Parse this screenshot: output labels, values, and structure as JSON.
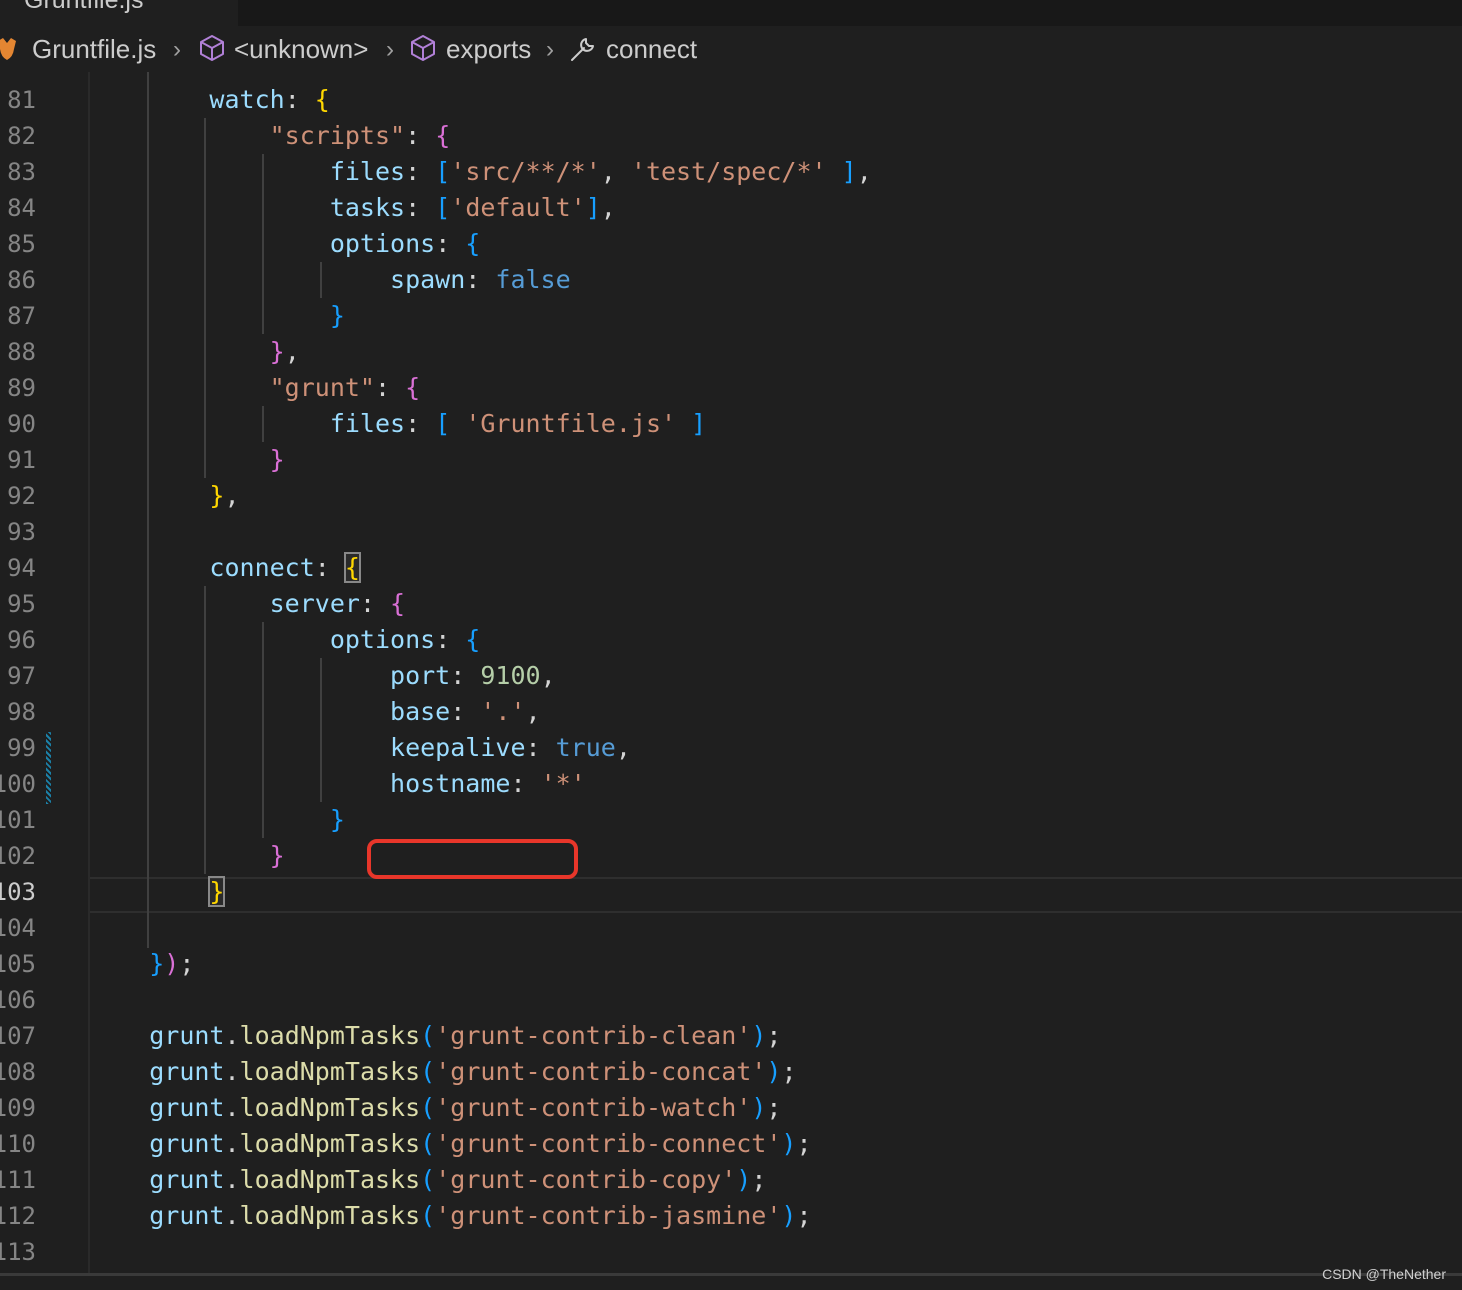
{
  "tab": {
    "label": "Gruntfile.js"
  },
  "breadcrumb": {
    "file": "Gruntfile.js",
    "items": [
      "<unknown>",
      "exports",
      "connect"
    ]
  },
  "editor": {
    "active_line": "103",
    "lines": [
      {
        "num": "81",
        "tokens": [
          {
            "t": "        ",
            "c": "p"
          },
          {
            "t": "watch",
            "c": "prop"
          },
          {
            "t": ": ",
            "c": "p"
          },
          {
            "t": "{",
            "c": "b1"
          }
        ]
      },
      {
        "num": "82",
        "tokens": [
          {
            "t": "            ",
            "c": "p"
          },
          {
            "t": "\"scripts\"",
            "c": "str"
          },
          {
            "t": ": ",
            "c": "p"
          },
          {
            "t": "{",
            "c": "b2"
          }
        ]
      },
      {
        "num": "83",
        "tokens": [
          {
            "t": "                ",
            "c": "p"
          },
          {
            "t": "files",
            "c": "prop"
          },
          {
            "t": ": ",
            "c": "p"
          },
          {
            "t": "[",
            "c": "b3"
          },
          {
            "t": "'src/**/*'",
            "c": "str"
          },
          {
            "t": ", ",
            "c": "p"
          },
          {
            "t": "'test/spec/*'",
            "c": "str"
          },
          {
            "t": " ",
            "c": "p"
          },
          {
            "t": "]",
            "c": "b3"
          },
          {
            "t": ",",
            "c": "p"
          }
        ]
      },
      {
        "num": "84",
        "tokens": [
          {
            "t": "                ",
            "c": "p"
          },
          {
            "t": "tasks",
            "c": "prop"
          },
          {
            "t": ": ",
            "c": "p"
          },
          {
            "t": "[",
            "c": "b3"
          },
          {
            "t": "'default'",
            "c": "str"
          },
          {
            "t": "]",
            "c": "b3"
          },
          {
            "t": ",",
            "c": "p"
          }
        ]
      },
      {
        "num": "85",
        "tokens": [
          {
            "t": "                ",
            "c": "p"
          },
          {
            "t": "options",
            "c": "prop"
          },
          {
            "t": ": ",
            "c": "p"
          },
          {
            "t": "{",
            "c": "b3"
          }
        ]
      },
      {
        "num": "86",
        "tokens": [
          {
            "t": "                    ",
            "c": "p"
          },
          {
            "t": "spawn",
            "c": "prop"
          },
          {
            "t": ": ",
            "c": "p"
          },
          {
            "t": "false",
            "c": "bool"
          }
        ]
      },
      {
        "num": "87",
        "tokens": [
          {
            "t": "                ",
            "c": "p"
          },
          {
            "t": "}",
            "c": "b3"
          }
        ]
      },
      {
        "num": "88",
        "tokens": [
          {
            "t": "            ",
            "c": "p"
          },
          {
            "t": "}",
            "c": "b2"
          },
          {
            "t": ",",
            "c": "p"
          }
        ]
      },
      {
        "num": "89",
        "tokens": [
          {
            "t": "            ",
            "c": "p"
          },
          {
            "t": "\"grunt\"",
            "c": "str"
          },
          {
            "t": ": ",
            "c": "p"
          },
          {
            "t": "{",
            "c": "b2"
          }
        ]
      },
      {
        "num": "90",
        "tokens": [
          {
            "t": "                ",
            "c": "p"
          },
          {
            "t": "files",
            "c": "prop"
          },
          {
            "t": ": ",
            "c": "p"
          },
          {
            "t": "[",
            "c": "b3"
          },
          {
            "t": " ",
            "c": "p"
          },
          {
            "t": "'Gruntfile.js'",
            "c": "str"
          },
          {
            "t": " ",
            "c": "p"
          },
          {
            "t": "]",
            "c": "b3"
          }
        ]
      },
      {
        "num": "91",
        "tokens": [
          {
            "t": "            ",
            "c": "p"
          },
          {
            "t": "}",
            "c": "b2"
          }
        ]
      },
      {
        "num": "92",
        "tokens": [
          {
            "t": "        ",
            "c": "p"
          },
          {
            "t": "}",
            "c": "b1"
          },
          {
            "t": ",",
            "c": "p"
          }
        ]
      },
      {
        "num": "93",
        "tokens": []
      },
      {
        "num": "94",
        "tokens": [
          {
            "t": "        ",
            "c": "p"
          },
          {
            "t": "connect",
            "c": "prop"
          },
          {
            "t": ": ",
            "c": "p"
          },
          {
            "t": "{",
            "c": "b1",
            "m": true
          }
        ]
      },
      {
        "num": "95",
        "tokens": [
          {
            "t": "            ",
            "c": "p"
          },
          {
            "t": "server",
            "c": "prop"
          },
          {
            "t": ": ",
            "c": "p"
          },
          {
            "t": "{",
            "c": "b2"
          }
        ]
      },
      {
        "num": "96",
        "tokens": [
          {
            "t": "                ",
            "c": "p"
          },
          {
            "t": "options",
            "c": "prop"
          },
          {
            "t": ": ",
            "c": "p"
          },
          {
            "t": "{",
            "c": "b3"
          }
        ]
      },
      {
        "num": "97",
        "tokens": [
          {
            "t": "                    ",
            "c": "p"
          },
          {
            "t": "port",
            "c": "prop"
          },
          {
            "t": ": ",
            "c": "p"
          },
          {
            "t": "9100",
            "c": "num"
          },
          {
            "t": ",",
            "c": "p"
          }
        ]
      },
      {
        "num": "98",
        "tokens": [
          {
            "t": "                    ",
            "c": "p"
          },
          {
            "t": "base",
            "c": "prop"
          },
          {
            "t": ": ",
            "c": "p"
          },
          {
            "t": "'.'",
            "c": "str"
          },
          {
            "t": ",",
            "c": "p"
          }
        ]
      },
      {
        "num": "99",
        "tokens": [
          {
            "t": "                    ",
            "c": "p"
          },
          {
            "t": "keepalive",
            "c": "prop"
          },
          {
            "t": ": ",
            "c": "p"
          },
          {
            "t": "true",
            "c": "bool"
          },
          {
            "t": ",",
            "c": "p"
          }
        ]
      },
      {
        "num": "100",
        "tokens": [
          {
            "t": "                    ",
            "c": "p"
          },
          {
            "t": "hostname",
            "c": "prop"
          },
          {
            "t": ": ",
            "c": "p"
          },
          {
            "t": "'*'",
            "c": "str"
          }
        ]
      },
      {
        "num": "101",
        "tokens": [
          {
            "t": "                ",
            "c": "p"
          },
          {
            "t": "}",
            "c": "b3"
          }
        ]
      },
      {
        "num": "102",
        "tokens": [
          {
            "t": "            ",
            "c": "p"
          },
          {
            "t": "}",
            "c": "b2"
          }
        ]
      },
      {
        "num": "103",
        "tokens": [
          {
            "t": "        ",
            "c": "p"
          },
          {
            "t": "}",
            "c": "b1",
            "m": true
          }
        ]
      },
      {
        "num": "104",
        "tokens": []
      },
      {
        "num": "105",
        "tokens": [
          {
            "t": "    ",
            "c": "p"
          },
          {
            "t": "}",
            "c": "b3"
          },
          {
            "t": ")",
            "c": "b2"
          },
          {
            "t": ";",
            "c": "p"
          }
        ]
      },
      {
        "num": "106",
        "tokens": []
      },
      {
        "num": "107",
        "tokens": [
          {
            "t": "    ",
            "c": "p"
          },
          {
            "t": "grunt",
            "c": "var"
          },
          {
            "t": ".",
            "c": "p"
          },
          {
            "t": "loadNpmTasks",
            "c": "fn"
          },
          {
            "t": "(",
            "c": "b3"
          },
          {
            "t": "'grunt-contrib-clean'",
            "c": "str"
          },
          {
            "t": ")",
            "c": "b3"
          },
          {
            "t": ";",
            "c": "p"
          }
        ]
      },
      {
        "num": "108",
        "tokens": [
          {
            "t": "    ",
            "c": "p"
          },
          {
            "t": "grunt",
            "c": "var"
          },
          {
            "t": ".",
            "c": "p"
          },
          {
            "t": "loadNpmTasks",
            "c": "fn"
          },
          {
            "t": "(",
            "c": "b3"
          },
          {
            "t": "'grunt-contrib-concat'",
            "c": "str"
          },
          {
            "t": ")",
            "c": "b3"
          },
          {
            "t": ";",
            "c": "p"
          }
        ]
      },
      {
        "num": "109",
        "tokens": [
          {
            "t": "    ",
            "c": "p"
          },
          {
            "t": "grunt",
            "c": "var"
          },
          {
            "t": ".",
            "c": "p"
          },
          {
            "t": "loadNpmTasks",
            "c": "fn"
          },
          {
            "t": "(",
            "c": "b3"
          },
          {
            "t": "'grunt-contrib-watch'",
            "c": "str"
          },
          {
            "t": ")",
            "c": "b3"
          },
          {
            "t": ";",
            "c": "p"
          }
        ]
      },
      {
        "num": "110",
        "tokens": [
          {
            "t": "    ",
            "c": "p"
          },
          {
            "t": "grunt",
            "c": "var"
          },
          {
            "t": ".",
            "c": "p"
          },
          {
            "t": "loadNpmTasks",
            "c": "fn"
          },
          {
            "t": "(",
            "c": "b3"
          },
          {
            "t": "'grunt-contrib-connect'",
            "c": "str"
          },
          {
            "t": ")",
            "c": "b3"
          },
          {
            "t": ";",
            "c": "p"
          }
        ]
      },
      {
        "num": "111",
        "tokens": [
          {
            "t": "    ",
            "c": "p"
          },
          {
            "t": "grunt",
            "c": "var"
          },
          {
            "t": ".",
            "c": "p"
          },
          {
            "t": "loadNpmTasks",
            "c": "fn"
          },
          {
            "t": "(",
            "c": "b3"
          },
          {
            "t": "'grunt-contrib-copy'",
            "c": "str"
          },
          {
            "t": ")",
            "c": "b3"
          },
          {
            "t": ";",
            "c": "p"
          }
        ]
      },
      {
        "num": "112",
        "tokens": [
          {
            "t": "    ",
            "c": "p"
          },
          {
            "t": "grunt",
            "c": "var"
          },
          {
            "t": ".",
            "c": "p"
          },
          {
            "t": "loadNpmTasks",
            "c": "fn"
          },
          {
            "t": "(",
            "c": "b3"
          },
          {
            "t": "'grunt-contrib-jasmine'",
            "c": "str"
          },
          {
            "t": ")",
            "c": "b3"
          },
          {
            "t": ";",
            "c": "p"
          }
        ]
      },
      {
        "num": "113",
        "tokens": []
      }
    ]
  },
  "watermark": "CSDN @TheNether",
  "colors": {
    "background": "#1f1f1f",
    "highlight_box": "#e8362a",
    "property": "#9cdcfe",
    "string": "#ce9178",
    "number": "#b5cea8",
    "keyword": "#569cd6",
    "function": "#dcdcaa",
    "bracket_level1": "#ffd700",
    "bracket_level2": "#da70d6",
    "bracket_level3": "#179fff"
  },
  "icons": {
    "file": "grunt-file-icon",
    "symbols": [
      "cube-icon",
      "cube-icon",
      "wrench-icon"
    ],
    "separator": "chevron-right-icon"
  }
}
